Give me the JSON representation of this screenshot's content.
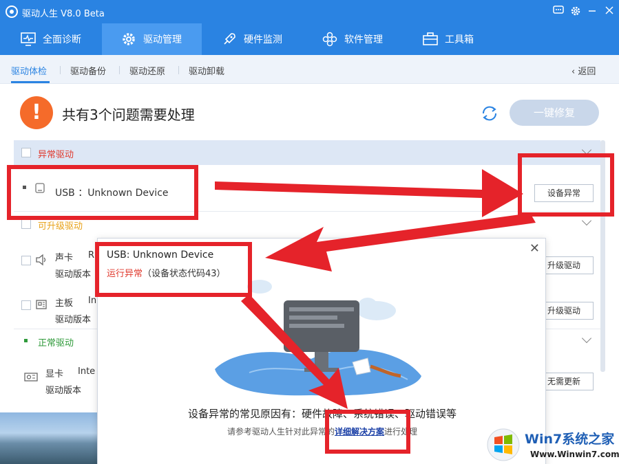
{
  "app": {
    "title": "驱动人生 V8.0 Beta"
  },
  "main_nav": [
    {
      "label": "全面诊断"
    },
    {
      "label": "驱动管理"
    },
    {
      "label": "硬件监测"
    },
    {
      "label": "软件管理"
    },
    {
      "label": "工具箱"
    }
  ],
  "sub_nav": [
    {
      "label": "驱动体检"
    },
    {
      "label": "驱动备份"
    },
    {
      "label": "驱动还原"
    },
    {
      "label": "驱动卸载"
    }
  ],
  "back_label": "返回",
  "summary": {
    "text": "共有3个问题需要处理",
    "fix_button": "一键修复"
  },
  "sections": {
    "abnormal": {
      "title": "异常驱动",
      "color": "#e03a2e"
    },
    "upgradable": {
      "title": "可升级驱动",
      "color": "#e8a21a"
    },
    "normal": {
      "title": "正常驱动",
      "color": "#2f9a3a"
    }
  },
  "abnormal_item": {
    "name": "USB ：Unknown Device",
    "button": "设备异常"
  },
  "upgrade_items": [
    {
      "type": "声卡",
      "name_partial": "R",
      "version_label": "驱动版本",
      "button": "升级驱动"
    },
    {
      "type": "主板",
      "name_partial": "In",
      "version_label": "驱动版本",
      "button": "升级驱动"
    }
  ],
  "normal_item": {
    "type": "显卡",
    "name_partial": "Inte",
    "version_label": "驱动版本",
    "button": "无需更新"
  },
  "dialog": {
    "title": "USB: Unknown Device",
    "status": "运行异常",
    "status_code": "（设备状态代码43）",
    "cause": "设备异常的常见原因有：硬件故障、系统错误、驱动错误等",
    "sub_prefix": "请参考驱动人生针对此异常的",
    "sub_link": "详细解决方案",
    "sub_suffix": "进行处理"
  },
  "watermark": {
    "brand": "Win7系统之家",
    "url": "Www.Winwin7.com"
  },
  "colors": {
    "accent": "#2a83e2",
    "warn": "#f56b2a",
    "annotation": "#e5232a"
  }
}
